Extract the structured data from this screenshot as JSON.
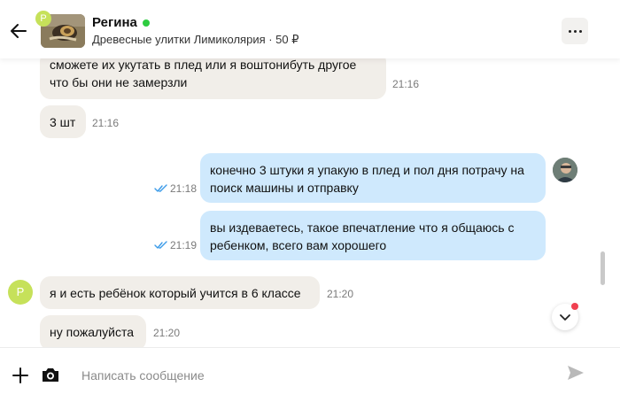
{
  "header": {
    "contact_name": "Регина",
    "avatar_initial": "Р",
    "listing_title": "Древесные улитки Лимиколярия · 50 ₽",
    "status_color": "#2ecc40"
  },
  "messages": [
    {
      "line1": "сможете их укутать в плед или я воштонибуть другое",
      "line2": "что бы они не замерзли",
      "time": "21:16"
    },
    {
      "text": "3 шт",
      "time": "21:16"
    },
    {
      "line1": "конечно 3 штуки я упакую в плед и пол дня потрачу на",
      "line2": "поиск машины и отправку",
      "time": "21:18"
    },
    {
      "line1": "вы издеваетесь, такое впечатление что я общаюсь с",
      "line2": "ребенком, всего вам хорошего",
      "time": "21:19"
    },
    {
      "text": "я и есть ребёнок который учится в 6 классе",
      "time": "21:20"
    },
    {
      "text": "ну пожалуйста",
      "time": "21:20"
    }
  ],
  "composer": {
    "placeholder": "Написать сообщение"
  },
  "icons": {
    "back": "arrow-left-icon",
    "more": "more-dots-icon",
    "plus": "plus-icon",
    "camera": "camera-icon",
    "send": "send-icon",
    "scroll_down": "chevron-down-icon",
    "read": "double-check-icon"
  },
  "colors": {
    "incoming_bubble": "#f1eee9",
    "outgoing_bubble": "#cfe9fd",
    "avatar_bg": "#c6e15a",
    "notification_dot": "#f04050",
    "read_ticks": "#3b9be8"
  }
}
